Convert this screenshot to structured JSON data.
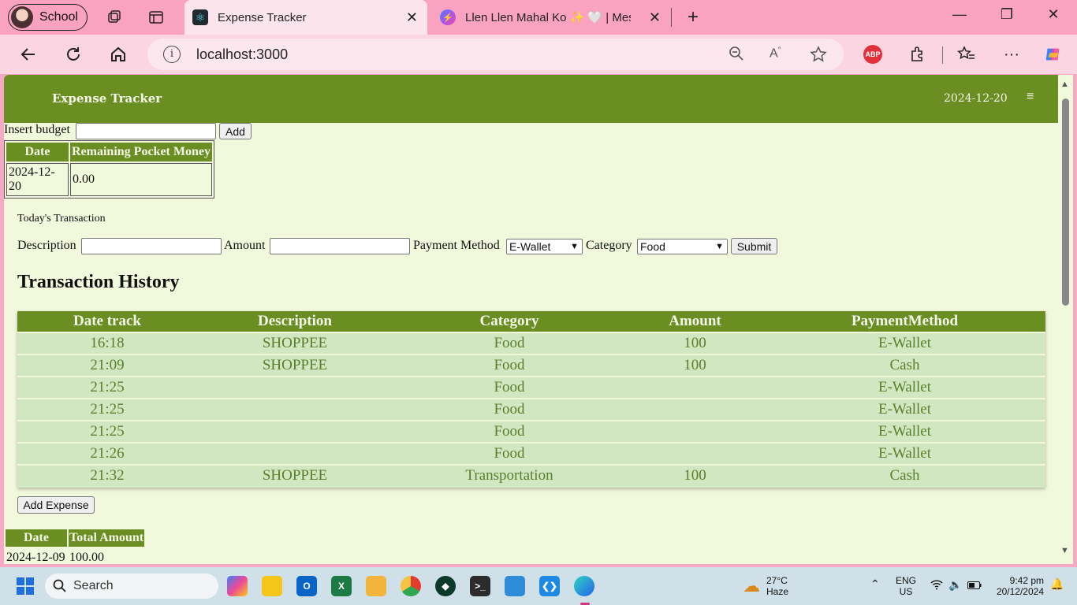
{
  "browser": {
    "profile_label": "School",
    "tabs": [
      {
        "title": "Expense Tracker",
        "active": true
      },
      {
        "title": "Llen Llen Mahal Ko ✨ 🤍 | Messenger",
        "active": false
      }
    ],
    "url": "localhost:3000",
    "abp_label": "ABP"
  },
  "app": {
    "title": "Expense Tracker",
    "date": "2024-12-20",
    "menu_icon": "≡"
  },
  "budget": {
    "label": "Insert budget",
    "input_value": "",
    "add_label": "Add",
    "table_headers": [
      "Date",
      "Remaining Pocket Money"
    ],
    "rows": [
      [
        "2024-12-20",
        "0.00"
      ]
    ]
  },
  "transaction_form": {
    "heading": "Today's Transaction",
    "description_label": "Description",
    "amount_label": "Amount",
    "payment_label": "Payment Method",
    "payment_value": "E-Wallet",
    "category_label": "Category",
    "category_value": "Food",
    "submit_label": "Submit"
  },
  "history": {
    "title": "Transaction History",
    "headers": [
      "Date track",
      "Description",
      "Category",
      "Amount",
      "PaymentMethod"
    ],
    "rows": [
      [
        "16:18",
        "SHOPPEE",
        "Food",
        "100",
        "E-Wallet"
      ],
      [
        "21:09",
        "SHOPPEE",
        "Food",
        "100",
        "Cash"
      ],
      [
        "21:25",
        "",
        "Food",
        "",
        "E-Wallet"
      ],
      [
        "21:25",
        "",
        "Food",
        "",
        "E-Wallet"
      ],
      [
        "21:25",
        "",
        "Food",
        "",
        "E-Wallet"
      ],
      [
        "21:26",
        "",
        "Food",
        "",
        "E-Wallet"
      ],
      [
        "21:32",
        "SHOPPEE",
        "Transportation",
        "100",
        "Cash"
      ]
    ],
    "add_expense_label": "Add Expense"
  },
  "totals": {
    "headers": [
      "Date",
      "Total Amount"
    ],
    "rows": [
      [
        "2024-12-09",
        "100.00"
      ]
    ]
  },
  "taskbar": {
    "search_placeholder": "Search",
    "weather_temp": "27°C",
    "weather_desc": "Haze",
    "lang_top": "ENG",
    "lang_bottom": "US",
    "time": "9:42 pm",
    "date": "20/12/2024"
  },
  "colors": {
    "header_green": "#6b8e23",
    "page_bg": "#f1f8dc",
    "row_bg": "#d0e7c2",
    "browser_pink": "#f9a3c0"
  }
}
